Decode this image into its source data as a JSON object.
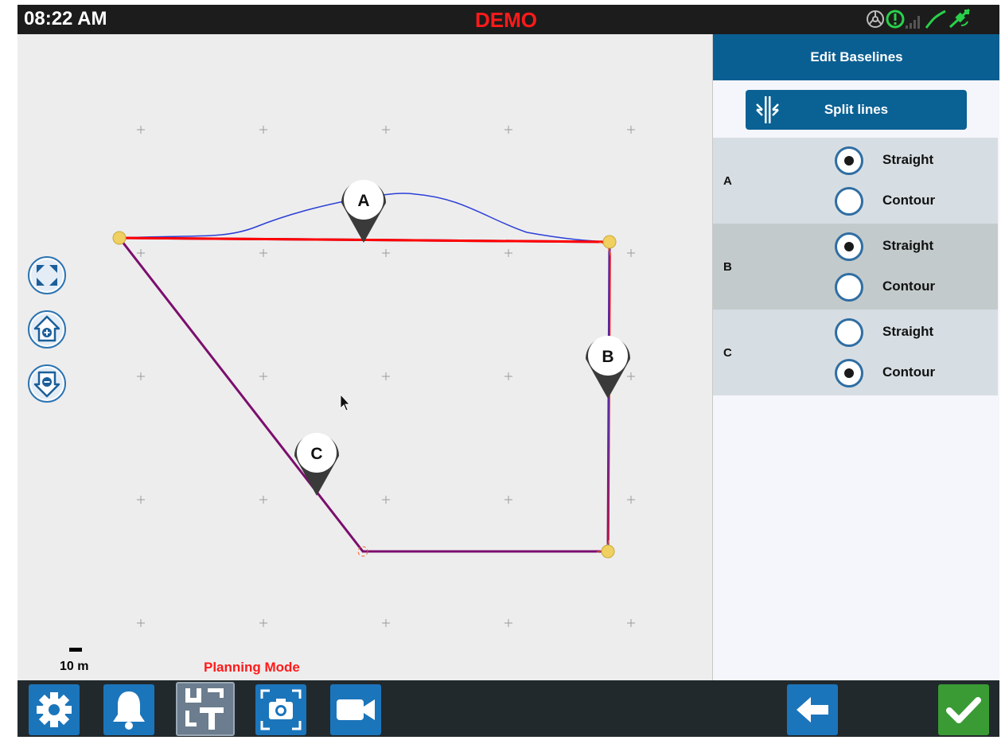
{
  "status": {
    "time": "08:22 AM",
    "mode_badge": "DEMO",
    "icons": [
      "steering-wheel-icon",
      "rtk-status-icon",
      "cell-signal-icon",
      "correction-signal-icon",
      "gps-satellite-icon"
    ]
  },
  "map": {
    "scale_label": "10 m",
    "mode_label": "Planning Mode",
    "markers": [
      {
        "label": "A"
      },
      {
        "label": "B"
      },
      {
        "label": "C"
      }
    ],
    "controls": [
      "fit-extents-icon",
      "zoom-in-icon",
      "zoom-out-icon"
    ]
  },
  "panel": {
    "title": "Edit Baselines",
    "split_button": "Split lines",
    "lines": [
      {
        "name": "A",
        "options": [
          "Straight",
          "Contour"
        ],
        "selected": "Straight"
      },
      {
        "name": "B",
        "options": [
          "Straight",
          "Contour"
        ],
        "selected": "Straight"
      },
      {
        "name": "C",
        "options": [
          "Straight",
          "Contour"
        ],
        "selected": "Contour"
      }
    ]
  },
  "toolbar": {
    "buttons": [
      "settings-icon",
      "alarm-bell-icon",
      "uturn-icon",
      "camera-icon",
      "video-camera-icon",
      "back-arrow-icon",
      "confirm-check-icon"
    ]
  },
  "colors": {
    "accent_blue": "#0a5f92",
    "button_blue": "#1b75bb",
    "confirm_green": "#3a9b35",
    "demo_red": "#ff1a1a",
    "baseline_red": "#ff0000",
    "contour_blue": "#2b3fd6",
    "boundary_purple": "#7b0e6e",
    "vertex_yellow": "#f0d060"
  }
}
